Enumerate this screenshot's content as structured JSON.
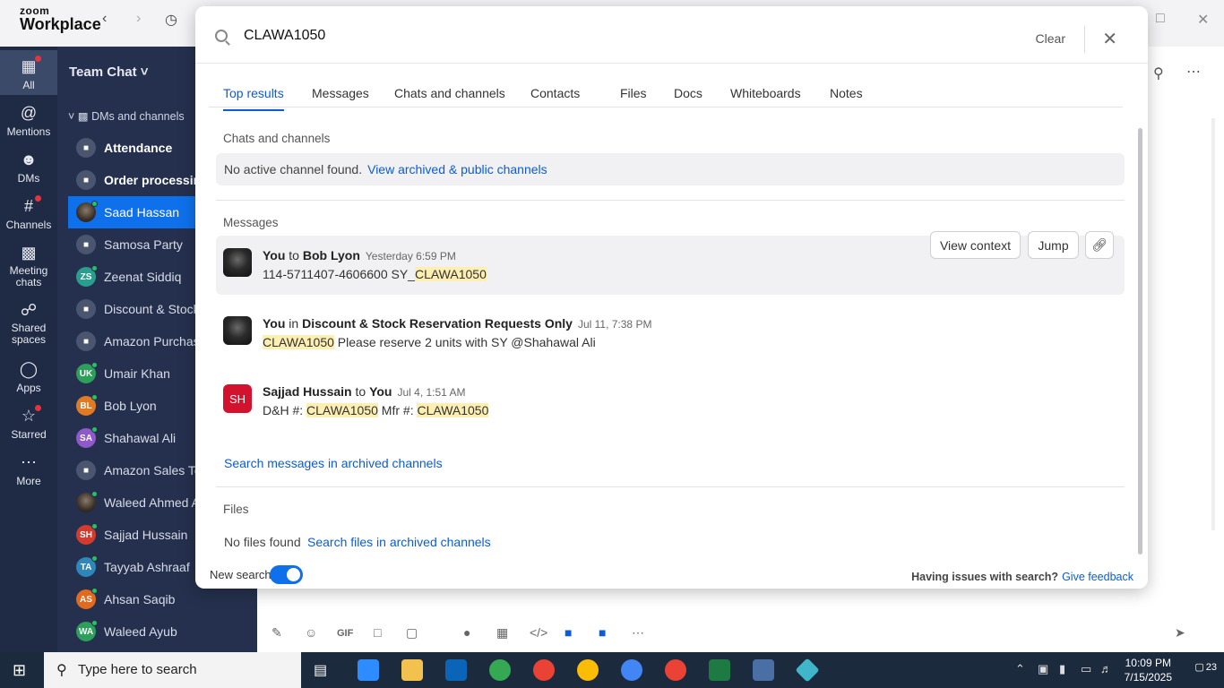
{
  "app": {
    "brand_top": "zoom",
    "brand_bottom": "Workplace"
  },
  "rail": [
    {
      "label": "All",
      "icon": "chat-bubble-icon"
    },
    {
      "label": "Mentions",
      "icon": "at-icon"
    },
    {
      "label": "DMs",
      "icon": "people-icon"
    },
    {
      "label": "Channels",
      "icon": "hash-icon"
    },
    {
      "label": "Meeting chats",
      "icon": "calendar-icon"
    },
    {
      "label": "Shared spaces",
      "icon": "shared-icon"
    },
    {
      "label": "Apps",
      "icon": "apps-icon"
    },
    {
      "label": "Starred",
      "icon": "star-icon"
    },
    {
      "label": "More",
      "icon": "more-icon"
    }
  ],
  "sidebar": {
    "title": "Team Chat",
    "section": "DMs and channels",
    "items": [
      {
        "label": "Attendance",
        "type": "lock",
        "bold": true
      },
      {
        "label": "Order processing",
        "type": "lock",
        "bold": true
      },
      {
        "label": "Saad Hassan",
        "type": "photo",
        "selected": true
      },
      {
        "label": "Samosa Party",
        "type": "lock"
      },
      {
        "label": "Zeenat Siddiq",
        "initials": "ZS",
        "color": "#2a9d8f"
      },
      {
        "label": "Discount & Stock",
        "type": "lock"
      },
      {
        "label": "Amazon Purchasi",
        "type": "lock"
      },
      {
        "label": "Umair Khan",
        "initials": "UK",
        "color": "#2e9e5b"
      },
      {
        "label": "Bob Lyon",
        "initials": "BL",
        "color": "#e07b24"
      },
      {
        "label": "Shahawal Ali",
        "initials": "SA",
        "color": "#8e59c8"
      },
      {
        "label": "Amazon Sales Te",
        "type": "lock"
      },
      {
        "label": "Waleed Ahmed A",
        "type": "photo"
      },
      {
        "label": "Sajjad Hussain",
        "initials": "SH",
        "color": "#d23b2e"
      },
      {
        "label": "Tayyab Ashraaf",
        "initials": "TA",
        "color": "#2f86b8"
      },
      {
        "label": "Ahsan Saqib",
        "initials": "AS",
        "color": "#e06a1f"
      },
      {
        "label": "Waleed Ayub",
        "initials": "WA",
        "color": "#2e9e5b"
      }
    ]
  },
  "search": {
    "query": "CLAWA1050",
    "clear_label": "Clear",
    "tabs": [
      "Top results",
      "Messages",
      "Chats and channels",
      "Contacts",
      "Files",
      "Docs",
      "Whiteboards",
      "Notes"
    ],
    "chats_section_title": "Chats and channels",
    "no_channel_text": "No active channel found.",
    "view_archived_link": "View archived & public channels",
    "messages_section_title": "Messages",
    "messages": [
      {
        "sender": "You",
        "connector": "to",
        "target": "Bob Lyon",
        "time": "Yesterday 6:59 PM",
        "body_pre": "114-5711407-4606600 SY_",
        "body_hl": "CLAWA1050",
        "body_post": ""
      },
      {
        "sender": "You",
        "connector": "in",
        "target": "Discount & Stock Reservation Requests Only",
        "time": "Jul 11, 7:38 PM",
        "body_pre": "",
        "body_hl": "CLAWA1050",
        "body_post": " Please reserve 2 units with SY @Shahawal Ali"
      },
      {
        "sender": "Sajjad Hussain",
        "connector": "to",
        "target": "You",
        "time": "Jul 4, 1:51 AM",
        "initials": "SH",
        "body_pre": "D&H #: ",
        "body_hl": "CLAWA1050",
        "body_mid": " Mfr #: ",
        "body_hl2": "CLAWA1050"
      }
    ],
    "view_context_label": "View context",
    "jump_label": "Jump",
    "search_archived_messages": "Search messages in archived channels",
    "files_section_title": "Files",
    "no_files_text": "No files found",
    "search_archived_files": "Search files in archived channels",
    "new_search_label": "New search",
    "issues_text": "Having issues with search?",
    "feedback_link": "Give feedback"
  },
  "taskbar": {
    "search_placeholder": "Type here to search",
    "time": "10:09 PM",
    "date": "7/15/2025",
    "notif_count": "23"
  }
}
